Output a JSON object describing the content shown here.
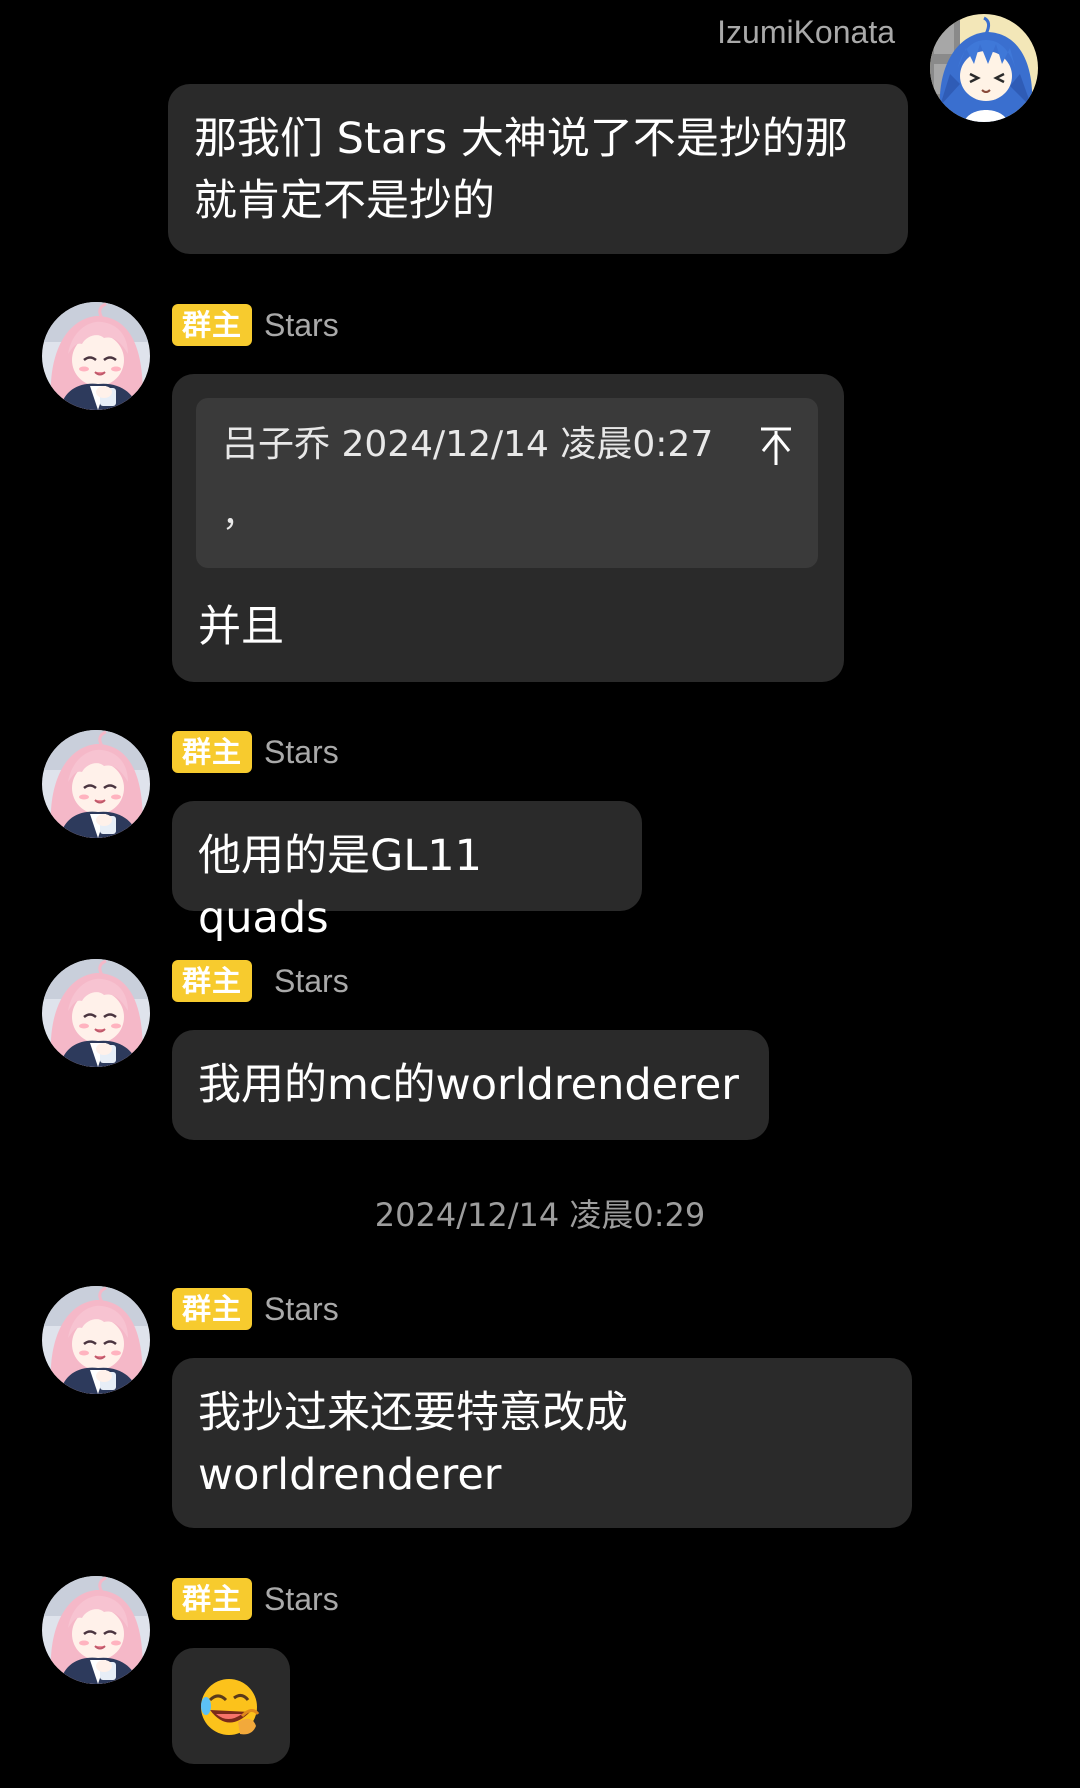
{
  "self_message": {
    "sender": "IzumiKonata",
    "text_line1": "那我们 Stars 大神说了不是抄的那",
    "text_line2": "就肯定不是抄的"
  },
  "owner_badge": "群主",
  "messages": [
    {
      "sender": "Stars",
      "quote_meta": "吕子乔 2024/12/14 凌晨0:27",
      "quote_text": "，",
      "text": "并且"
    },
    {
      "sender": "Stars",
      "text": "他用的是GL11 quads"
    },
    {
      "sender": "Stars",
      "text": "我用的mc的worldrenderer"
    },
    {
      "sender": "Stars",
      "text_line1": "我抄过来还要特意改成",
      "text_line2": "worldrenderer"
    },
    {
      "sender": "Stars",
      "emoji": "laughing-cry-emoji"
    }
  ],
  "timestamp": "2024/12/14 凌晨0:29",
  "colors": {
    "background": "#000000",
    "bubble": "#2a2a2a",
    "quote_box": "#3a3a3a",
    "owner_badge": "#f7cb2e",
    "name_text": "#a9a9a9",
    "timestamp_text": "#9d9d9d"
  }
}
